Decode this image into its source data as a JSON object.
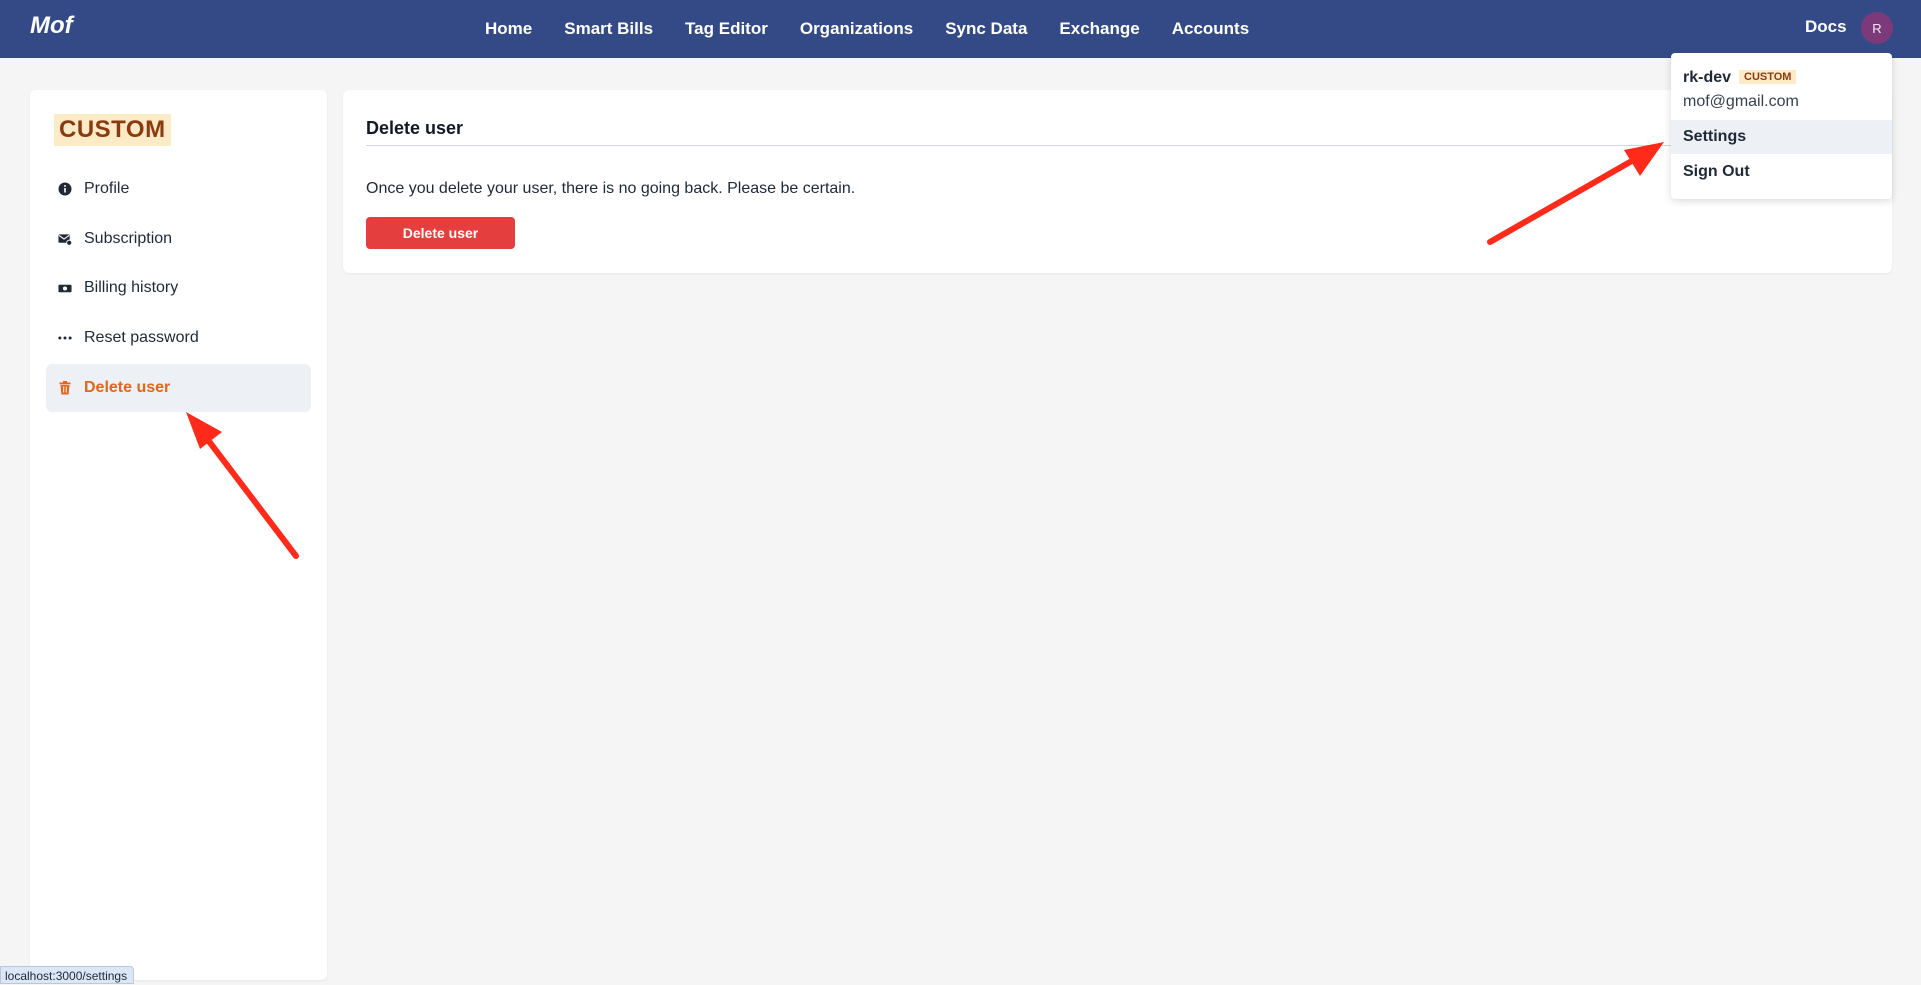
{
  "app": {
    "brand": "Mof"
  },
  "nav": {
    "items": [
      "Home",
      "Smart Bills",
      "Tag Editor",
      "Organizations",
      "Sync Data",
      "Exchange",
      "Accounts"
    ],
    "docs": "Docs",
    "avatar_initial": "R"
  },
  "sidebar": {
    "plan_badge": "CUSTOM",
    "items": [
      {
        "label": "Profile",
        "icon": "info-circle-icon"
      },
      {
        "label": "Subscription",
        "icon": "envelope-badge-icon"
      },
      {
        "label": "Billing history",
        "icon": "money-bill-icon"
      },
      {
        "label": "Reset password",
        "icon": "password-dots-icon"
      },
      {
        "label": "Delete user",
        "icon": "trash-icon",
        "active": true
      }
    ]
  },
  "main": {
    "title": "Delete user",
    "description": "Once you delete your user, there is no going back. Please be certain.",
    "button_label": "Delete user"
  },
  "dropdown": {
    "username": "rk-dev",
    "plan": "CUSTOM",
    "email": "mof@gmail.com",
    "items": [
      "Settings",
      "Sign Out"
    ]
  },
  "status_bar": {
    "url": "localhost:3000/settings"
  },
  "colors": {
    "topbar": "#334a87",
    "accent_active": "#e2661b",
    "danger": "#e53e3e",
    "badge_bg": "#fdebc8",
    "annotation_arrow": "#ff2a1a"
  }
}
